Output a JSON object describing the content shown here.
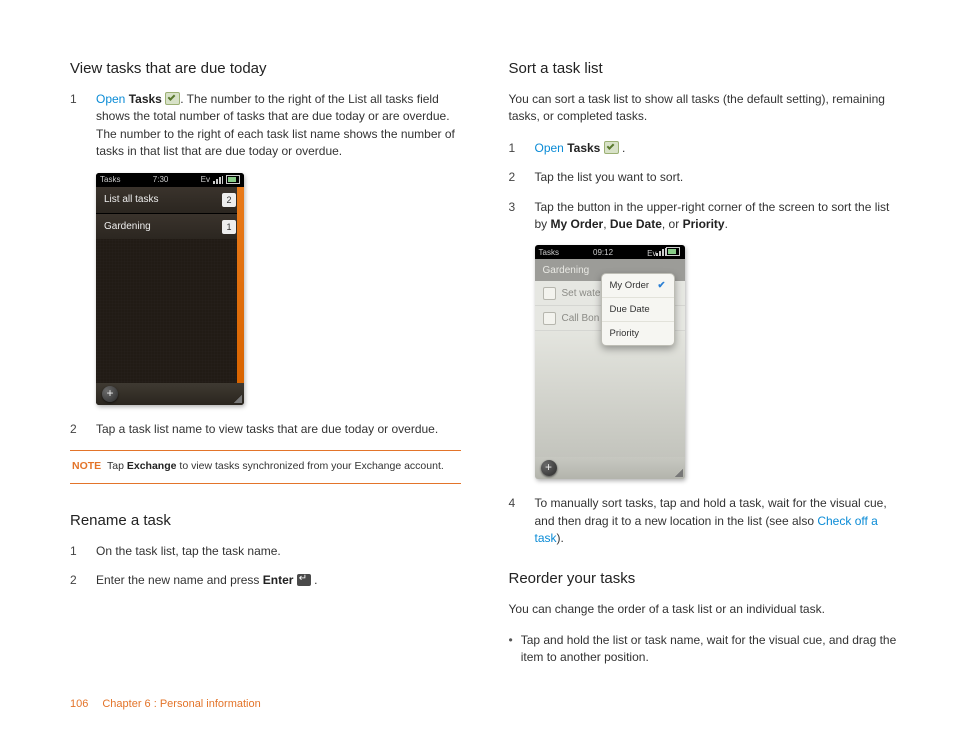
{
  "left": {
    "h_view": "View tasks that are due today",
    "step1_pre": "Open",
    "step1_bold": "Tasks",
    "step1_post": ". The number to the right of the List all tasks field shows the total number of tasks that are due today or are overdue. The number to the right of each task list name shows the number of tasks in that list that are due today or overdue.",
    "phone1": {
      "sb_left": "Tasks",
      "sb_time": "7:30",
      "row1": "List all tasks",
      "row1_badge": "2",
      "row2": "Gardening",
      "row2_badge": "1"
    },
    "step2": "Tap a task list name to view tasks that are due today or overdue.",
    "note_label": "NOTE",
    "note_pre": "Tap ",
    "note_bold": "Exchange",
    "note_post": " to view tasks synchronized from your Exchange account.",
    "h_rename": "Rename a task",
    "rename1": "On the task list, tap the task name.",
    "rename2_pre": "Enter the new name and press ",
    "rename2_bold": "Enter"
  },
  "right": {
    "h_sort": "Sort a task list",
    "intro": "You can sort a task list to show all tasks (the default setting), remaining tasks, or completed tasks.",
    "s1_pre": "Open",
    "s1_bold": "Tasks",
    "s2": "Tap the list you want to sort.",
    "s3_pre": "Tap the button in the upper-right corner of the screen to sort the list by ",
    "s3_b1": "My Order",
    "s3_b2": "Due Date",
    "s3_or": ", or ",
    "s3_b3": "Priority",
    "phone2": {
      "sb_left": "Tasks",
      "sb_time": "09:12",
      "hdr": "Gardening",
      "t1": "Set wate",
      "t2": "Call Bon",
      "m1": "My Order",
      "m2": "Due Date",
      "m3": "Priority"
    },
    "s4_pre": "To manually sort tasks, tap and hold a task, wait for the visual cue, and then drag it to a new location in the list (see also ",
    "s4_link": "Check off a task",
    "s4_post": ").",
    "h_reorder": "Reorder your tasks",
    "reorder_intro": "You can change the order of a task list or an individual task.",
    "reorder_b1": "Tap and hold the list or task name, wait for the visual cue, and drag the item to another position."
  },
  "footer": {
    "page": "106",
    "chapter": "Chapter 6 : Personal information"
  }
}
